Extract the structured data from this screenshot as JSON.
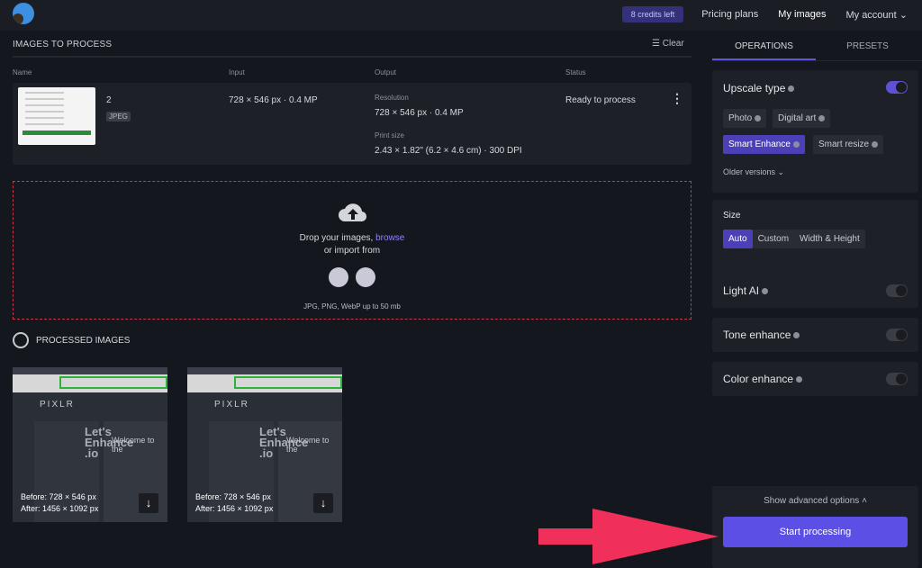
{
  "header": {
    "credits": "8 credits left",
    "nav": [
      "Pricing plans",
      "My images",
      "My account"
    ]
  },
  "queue": {
    "title": "IMAGES TO PROCESS",
    "clear": "Clear",
    "columns": [
      "Name",
      "Input",
      "Output",
      "Status"
    ],
    "item": {
      "name": "2",
      "format": "JPEG",
      "input": "728 × 546 px · 0.4 MP",
      "resolution_label": "Resolution",
      "resolution": "728 × 546 px · 0.4 MP",
      "print_label": "Print size",
      "print": "2.43 × 1.82\" (6.2 × 4.6 cm) · 300 DPI",
      "status": "Ready to process"
    }
  },
  "drop": {
    "text": "Drop your images,",
    "browse": "browse",
    "import": "or import from",
    "formats": "JPG, PNG, WebP up to 50 mb"
  },
  "processed": {
    "title": "PROCESSED IMAGES",
    "items": [
      {
        "before": "Before: 728 × 546 px",
        "after": "After: 1456 × 1092 px"
      },
      {
        "before": "Before: 728 × 546 px",
        "after": "After: 1456 × 1092 px"
      }
    ],
    "thumb_text": {
      "brand": "PIXLR",
      "lets": "Let's",
      "enhance": "Enhance",
      ".io": ".io",
      "welcome": "Welcome to the"
    }
  },
  "sidebar": {
    "tabs": [
      "OPERATIONS",
      "PRESETS"
    ],
    "upscale": {
      "title": "Upscale type",
      "enabled": true,
      "types": [
        "Photo",
        "Digital art",
        "Smart Enhance",
        "Smart resize"
      ],
      "selected": "Smart Enhance",
      "older": "Older versions"
    },
    "size": {
      "title": "Size",
      "options": [
        "Auto",
        "Custom",
        "Width & Height"
      ],
      "selected": "Auto"
    },
    "toggles": [
      {
        "label": "Light AI",
        "on": false
      },
      {
        "label": "Tone enhance",
        "on": false
      },
      {
        "label": "Color enhance",
        "on": false
      }
    ],
    "advanced": "Show advanced options",
    "start": "Start processing"
  },
  "colors": {
    "accent": "#5b4fe6",
    "annotation_arrow": "#f0305a",
    "drop_border": "#c7374a"
  }
}
